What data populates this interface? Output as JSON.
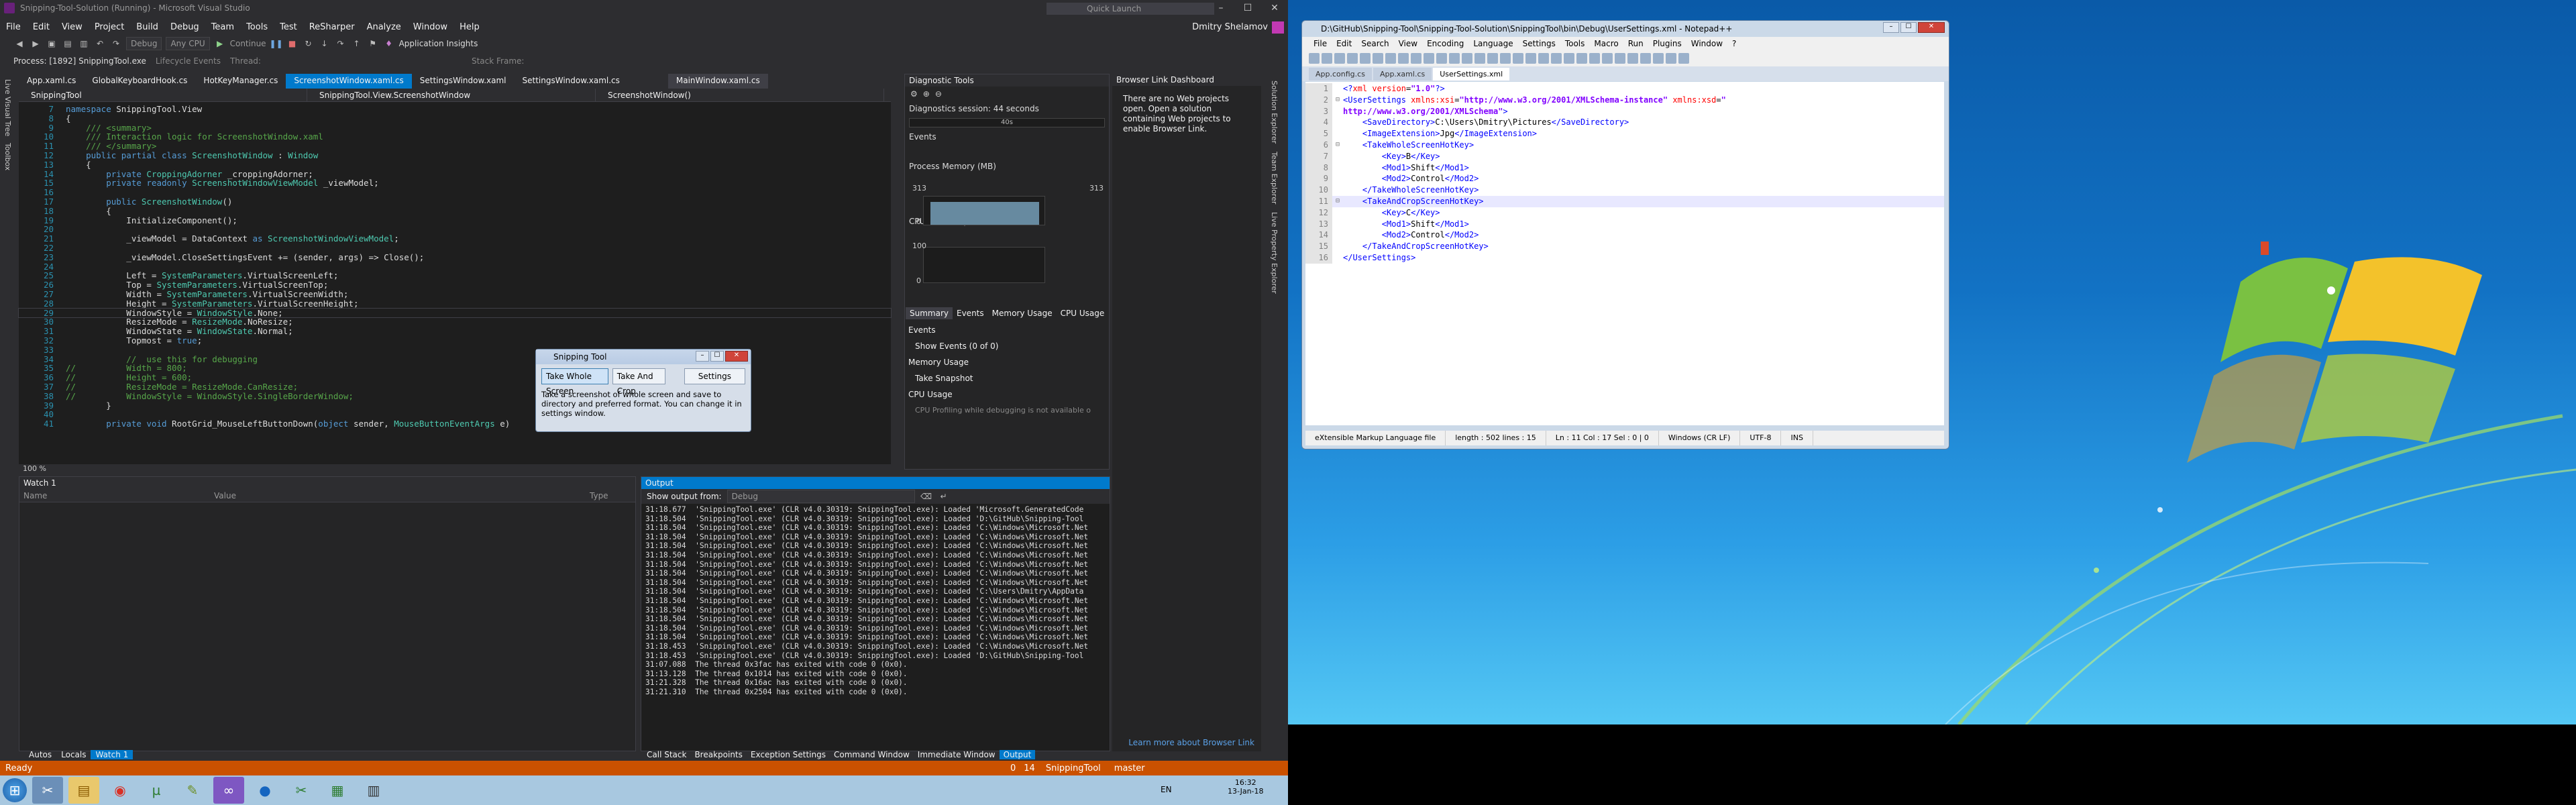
{
  "vs": {
    "title": "Snipping-Tool-Solution (Running) - Microsoft Visual Studio",
    "quick_launch": "Quick Launch",
    "user": "Dmitry Shelamov",
    "menu": [
      "File",
      "Edit",
      "View",
      "Project",
      "Build",
      "Debug",
      "Team",
      "Tools",
      "Test",
      "ReSharper",
      "Analyze",
      "Window",
      "Help"
    ],
    "toolbar": {
      "config": "Debug",
      "platform": "Any CPU",
      "continue": "Continue",
      "insights": "Application Insights"
    },
    "process_label": "Process: [1892] SnippingTool.exe",
    "lifecycle": "Lifecycle Events",
    "thread": "Thread:",
    "stack_frame": "Stack Frame:",
    "tabs": [
      {
        "label": "App.xaml.cs",
        "active": false
      },
      {
        "label": "GlobalKeyboardHook.cs",
        "active": false
      },
      {
        "label": "HotKeyManager.cs",
        "active": false
      },
      {
        "label": "ScreenshotWindow.xaml.cs",
        "active": true
      },
      {
        "label": "SettingsWindow.xaml",
        "active": false
      },
      {
        "label": "SettingsWindow.xaml.cs",
        "active": false
      }
    ],
    "file_tab": "MainWindow.xaml.cs",
    "nav": [
      "SnippingTool",
      "SnippingTool.View.ScreenshotWindow",
      "ScreenshotWindow()"
    ],
    "zoom": "100 %",
    "left_strip": [
      "Live Visual Tree",
      "Toolbox"
    ],
    "right_strip": [
      "Solution Explorer",
      "Team Explorer",
      "Live Property Explorer"
    ],
    "code": [
      {
        "n": "7",
        "t": [
          [
            "kw",
            "namespace "
          ],
          [
            "id",
            "SnippingTool.View"
          ]
        ]
      },
      {
        "n": "8",
        "t": [
          [
            "id",
            "{"
          ]
        ]
      },
      {
        "n": "9",
        "t": [
          [
            "cm",
            "    /// <summary>"
          ]
        ]
      },
      {
        "n": "10",
        "t": [
          [
            "cm",
            "    /// Interaction logic for ScreenshotWindow.xaml"
          ]
        ]
      },
      {
        "n": "11",
        "t": [
          [
            "cm",
            "    /// </summary>"
          ]
        ]
      },
      {
        "n": "12",
        "t": [
          [
            "kw",
            "    public partial class "
          ],
          [
            "ty",
            "ScreenshotWindow"
          ],
          [
            "id",
            " : "
          ],
          [
            "ty",
            "Window"
          ]
        ]
      },
      {
        "n": "13",
        "t": [
          [
            "id",
            "    {"
          ]
        ]
      },
      {
        "n": "14",
        "t": [
          [
            "kw",
            "        private "
          ],
          [
            "ty",
            "CroppingAdorner"
          ],
          [
            "id",
            " _croppingAdorner;"
          ]
        ]
      },
      {
        "n": "15",
        "t": [
          [
            "kw",
            "        private readonly "
          ],
          [
            "ty",
            "ScreenshotWindowViewModel"
          ],
          [
            "id",
            " _viewModel;"
          ]
        ]
      },
      {
        "n": "16",
        "t": [
          [
            "id",
            ""
          ]
        ]
      },
      {
        "n": "17",
        "t": [
          [
            "kw",
            "        public "
          ],
          [
            "ty",
            "ScreenshotWindow"
          ],
          [
            "id",
            "()"
          ]
        ]
      },
      {
        "n": "18",
        "t": [
          [
            "id",
            "        {"
          ]
        ]
      },
      {
        "n": "19",
        "t": [
          [
            "id",
            "            InitializeComponent();"
          ]
        ]
      },
      {
        "n": "20",
        "t": [
          [
            "id",
            ""
          ]
        ]
      },
      {
        "n": "21",
        "t": [
          [
            "id",
            "            _viewModel = DataContext "
          ],
          [
            "kw",
            "as "
          ],
          [
            "ty",
            "ScreenshotWindowViewModel"
          ],
          [
            "id",
            ";"
          ]
        ]
      },
      {
        "n": "22",
        "t": [
          [
            "id",
            ""
          ]
        ]
      },
      {
        "n": "23",
        "t": [
          [
            "id",
            "            _viewModel.CloseSettingsEvent += (sender, args) => Close();"
          ]
        ]
      },
      {
        "n": "24",
        "t": [
          [
            "id",
            ""
          ]
        ]
      },
      {
        "n": "25",
        "t": [
          [
            "id",
            "            Left = "
          ],
          [
            "ty",
            "SystemParameters"
          ],
          [
            "id",
            ".VirtualScreenLeft;"
          ]
        ]
      },
      {
        "n": "26",
        "t": [
          [
            "id",
            "            Top = "
          ],
          [
            "ty",
            "SystemParameters"
          ],
          [
            "id",
            ".VirtualScreenTop;"
          ]
        ]
      },
      {
        "n": "27",
        "t": [
          [
            "id",
            "            Width = "
          ],
          [
            "ty",
            "SystemParameters"
          ],
          [
            "id",
            ".VirtualScreenWidth;"
          ]
        ]
      },
      {
        "n": "28",
        "t": [
          [
            "id",
            "            Height = "
          ],
          [
            "ty",
            "SystemParameters"
          ],
          [
            "id",
            ".VirtualScreenHeight;"
          ]
        ]
      },
      {
        "n": "29",
        "t": [
          [
            "id",
            "            WindowStyle = "
          ],
          [
            "ty",
            "WindowStyle"
          ],
          [
            "id",
            ".None;"
          ]
        ]
      },
      {
        "n": "30",
        "t": [
          [
            "id",
            "            ResizeMode = "
          ],
          [
            "ty",
            "ResizeMode"
          ],
          [
            "id",
            ".NoResize;"
          ]
        ]
      },
      {
        "n": "31",
        "t": [
          [
            "id",
            "            WindowState = "
          ],
          [
            "ty",
            "WindowState"
          ],
          [
            "id",
            ".Normal;"
          ]
        ]
      },
      {
        "n": "32",
        "t": [
          [
            "id",
            "            Topmost = "
          ],
          [
            "kw",
            "true"
          ],
          [
            "id",
            ";"
          ]
        ]
      },
      {
        "n": "33",
        "t": [
          [
            "id",
            ""
          ]
        ]
      },
      {
        "n": "34",
        "t": [
          [
            "cm",
            "            //  use this for debugging"
          ]
        ]
      },
      {
        "n": "35",
        "t": [
          [
            "cm",
            "//          Width = 800;"
          ]
        ]
      },
      {
        "n": "36",
        "t": [
          [
            "cm",
            "//          Height = 600;"
          ]
        ]
      },
      {
        "n": "37",
        "t": [
          [
            "cm",
            "//          ResizeMode = ResizeMode.CanResize;"
          ]
        ]
      },
      {
        "n": "38",
        "t": [
          [
            "cm",
            "//          WindowStyle = WindowStyle.SingleBorderWindow;"
          ]
        ]
      },
      {
        "n": "39",
        "t": [
          [
            "id",
            "        }"
          ]
        ]
      },
      {
        "n": "40",
        "t": [
          [
            "id",
            ""
          ]
        ]
      },
      {
        "n": "41",
        "t": [
          [
            "kw",
            "        private void "
          ],
          [
            "id",
            "RootGrid_MouseLeftButtonDown("
          ],
          [
            "kw",
            "object "
          ],
          [
            "id",
            "sender, "
          ],
          [
            "ty",
            "MouseButtonEventArgs"
          ],
          [
            "id",
            " e)"
          ]
        ]
      }
    ],
    "diag": {
      "title": "Diagnostic Tools",
      "session": "Diagnostics session: 44 seconds",
      "timer": "40s",
      "events": "Events",
      "memory": "Process Memory (MB)",
      "mem_top_left": "313",
      "mem_top_right": "313",
      "mem_zero": "0",
      "cpu": "CPU (% of all processors)",
      "cpu_top": "100",
      "cpu_zero": "0",
      "tabs": [
        "Summary",
        "Events",
        "Memory Usage",
        "CPU Usage"
      ],
      "events_head": "Events",
      "show_events": "Show Events (0 of 0)",
      "memory_usage": "Memory Usage",
      "take_snapshot": "Take Snapshot",
      "cpu_usage": "CPU Usage",
      "cpu_note": "CPU Profiling while debugging is not available o"
    },
    "browser_link": {
      "title": "Browser Link Dashboard",
      "message": "There are no Web projects open. Open a solution containing Web projects to enable Browser Link.",
      "footer": "Learn more about Browser Link"
    },
    "watch": {
      "title": "Watch 1",
      "cols": [
        "Name",
        "Value",
        "Type"
      ]
    },
    "output": {
      "title": "Output",
      "source_label": "Show output from:",
      "source": "Debug",
      "lines": [
        "31:18.677  'SnippingTool.exe' (CLR v4.0.30319: SnippingTool.exe): Loaded 'Microsoft.GeneratedCode",
        "31:18.504  'SnippingTool.exe' (CLR v4.0.30319: SnippingTool.exe): Loaded 'D:\\GitHub\\Snipping-Tool",
        "31:18.504  'SnippingTool.exe' (CLR v4.0.30319: SnippingTool.exe): Loaded 'C:\\Windows\\Microsoft.Net",
        "31:18.504  'SnippingTool.exe' (CLR v4.0.30319: SnippingTool.exe): Loaded 'C:\\Windows\\Microsoft.Net",
        "31:18.504  'SnippingTool.exe' (CLR v4.0.30319: SnippingTool.exe): Loaded 'C:\\Windows\\Microsoft.Net",
        "31:18.504  'SnippingTool.exe' (CLR v4.0.30319: SnippingTool.exe): Loaded 'C:\\Windows\\Microsoft.Net",
        "31:18.504  'SnippingTool.exe' (CLR v4.0.30319: SnippingTool.exe): Loaded 'C:\\Windows\\Microsoft.Net",
        "31:18.504  'SnippingTool.exe' (CLR v4.0.30319: SnippingTool.exe): Loaded 'C:\\Windows\\Microsoft.Net",
        "31:18.504  'SnippingTool.exe' (CLR v4.0.30319: SnippingTool.exe): Loaded 'C:\\Windows\\Microsoft.Net",
        "31:18.504  'SnippingTool.exe' (CLR v4.0.30319: SnippingTool.exe): Loaded 'C:\\Users\\Dmitry\\AppData",
        "31:18.504  'SnippingTool.exe' (CLR v4.0.30319: SnippingTool.exe): Loaded 'C:\\Windows\\Microsoft.Net",
        "31:18.504  'SnippingTool.exe' (CLR v4.0.30319: SnippingTool.exe): Loaded 'C:\\Windows\\Microsoft.Net",
        "31:18.504  'SnippingTool.exe' (CLR v4.0.30319: SnippingTool.exe): Loaded 'C:\\Windows\\Microsoft.Net",
        "31:18.504  'SnippingTool.exe' (CLR v4.0.30319: SnippingTool.exe): Loaded 'C:\\Windows\\Microsoft.Net",
        "31:18.504  'SnippingTool.exe' (CLR v4.0.30319: SnippingTool.exe): Loaded 'C:\\Windows\\Microsoft.Net",
        "31:18.453  'SnippingTool.exe' (CLR v4.0.30319: SnippingTool.exe): Loaded 'C:\\Windows\\Microsoft.Net",
        "31:18.453  'SnippingTool.exe' (CLR v4.0.30319: SnippingTool.exe): Loaded 'D:\\GitHub\\Snipping-Tool",
        "31:07.088  The thread 0x3fac has exited with code 0 (0x0).",
        "31:13.128  The thread 0x1014 has exited with code 0 (0x0).",
        "31:21.328  The thread 0x16ac has exited with code 0 (0x0).",
        "31:21.310  The thread 0x2504 has exited with code 0 (0x0)."
      ]
    },
    "bottom_tabs": [
      "Autos",
      "Locals",
      "Watch 1"
    ],
    "output_tabs": [
      "Call Stack",
      "Breakpoints",
      "Exception Settings",
      "Command Window",
      "Immediate Window",
      "Output"
    ],
    "status": {
      "left": "Ready",
      "errors": "0",
      "warnings": "14",
      "project": "SnippingTool",
      "branch": "master"
    }
  },
  "snip": {
    "title": "Snipping Tool",
    "buttons": [
      "Take Whole Screen",
      "Take And Crop",
      "Settings"
    ],
    "text": "Take a screenshot of whole screen and save to directory and preferred format. You can change it in settings window."
  },
  "taskbar": {
    "lang": "EN",
    "time": "16:32",
    "date": "13-Jan-18"
  },
  "npp": {
    "title": "D:\\GitHub\\Snipping-Tool\\Snipping-Tool-Solution\\SnippingTool\\bin\\Debug\\UserSettings.xml - Notepad++",
    "menu": [
      "File",
      "Edit",
      "Search",
      "View",
      "Encoding",
      "Language",
      "Settings",
      "Tools",
      "Macro",
      "Run",
      "Plugins",
      "Window",
      "?"
    ],
    "tabs": [
      "App.config.cs",
      "App.xaml.cs",
      "UserSettings.xml"
    ],
    "lines": [
      {
        "n": "1",
        "f": "",
        "p": [
          [
            "tg",
            "<?"
          ],
          [
            "at",
            "xml"
          ],
          [
            "tx",
            " "
          ],
          [
            "at",
            "version"
          ],
          [
            "tx",
            "="
          ],
          [
            "av",
            "\"1.0\""
          ],
          [
            "tg",
            "?>"
          ]
        ]
      },
      {
        "n": "2",
        "f": "⊟",
        "p": [
          [
            "tg",
            "<UserSettings "
          ],
          [
            "at",
            "xmlns:xsi"
          ],
          [
            "tx",
            "="
          ],
          [
            "av",
            "\"http://www.w3.org/2001/XMLSchema-instance\""
          ],
          [
            "tx",
            " "
          ],
          [
            "at",
            "xmlns:xsd"
          ],
          [
            "tx",
            "="
          ],
          [
            "av",
            "\""
          ]
        ]
      },
      {
        "n": "3",
        "f": "",
        "p": [
          [
            "av",
            "http://www.w3.org/2001/XMLSchema\""
          ],
          [
            "tg",
            ">"
          ]
        ]
      },
      {
        "n": "4",
        "f": "",
        "p": [
          [
            "tg",
            "    <SaveDirectory>"
          ],
          [
            "tx",
            "C:\\Users\\Dmitry\\Pictures"
          ],
          [
            "tg",
            "</SaveDirectory>"
          ]
        ]
      },
      {
        "n": "5",
        "f": "",
        "p": [
          [
            "tg",
            "    <ImageExtension>"
          ],
          [
            "tx",
            "Jpg"
          ],
          [
            "tg",
            "</ImageExtension>"
          ]
        ]
      },
      {
        "n": "6",
        "f": "⊟",
        "p": [
          [
            "tg",
            "    <TakeWholeScreenHotKey>"
          ]
        ]
      },
      {
        "n": "7",
        "f": "",
        "p": [
          [
            "tg",
            "        <Key>"
          ],
          [
            "tx",
            "B"
          ],
          [
            "tg",
            "</Key>"
          ]
        ]
      },
      {
        "n": "8",
        "f": "",
        "p": [
          [
            "tg",
            "        <Mod1>"
          ],
          [
            "tx",
            "Shift"
          ],
          [
            "tg",
            "</Mod1>"
          ]
        ]
      },
      {
        "n": "9",
        "f": "",
        "p": [
          [
            "tg",
            "        <Mod2>"
          ],
          [
            "tx",
            "Control"
          ],
          [
            "tg",
            "</Mod2>"
          ]
        ]
      },
      {
        "n": "10",
        "f": "",
        "p": [
          [
            "tg",
            "    </TakeWholeScreenHotKey>"
          ]
        ]
      },
      {
        "n": "11",
        "f": "⊟",
        "p": [
          [
            "tg",
            "    <TakeAndCropScreenHotKey>"
          ]
        ]
      },
      {
        "n": "12",
        "f": "",
        "p": [
          [
            "tg",
            "        <Key>"
          ],
          [
            "tx",
            "C"
          ],
          [
            "tg",
            "</Key>"
          ]
        ]
      },
      {
        "n": "13",
        "f": "",
        "p": [
          [
            "tg",
            "        <Mod1>"
          ],
          [
            "tx",
            "Shift"
          ],
          [
            "tg",
            "</Mod1>"
          ]
        ]
      },
      {
        "n": "14",
        "f": "",
        "p": [
          [
            "tg",
            "        <Mod2>"
          ],
          [
            "tx",
            "Control"
          ],
          [
            "tg",
            "</Mod2>"
          ]
        ]
      },
      {
        "n": "15",
        "f": "",
        "p": [
          [
            "tg",
            "    </TakeAndCropScreenHotKey>"
          ]
        ]
      },
      {
        "n": "16",
        "f": "",
        "p": [
          [
            "tg",
            "</UserSettings>"
          ]
        ]
      }
    ],
    "status": [
      "eXtensible Markup Language file",
      "length : 502    lines : 15",
      "Ln : 11    Col : 17    Sel : 0 | 0",
      "Windows (CR LF)",
      "UTF-8",
      "INS"
    ]
  },
  "colors": {
    "vs_accent": "#007acc",
    "vs_status": "#ca5100",
    "desktop": "#1272c4"
  }
}
